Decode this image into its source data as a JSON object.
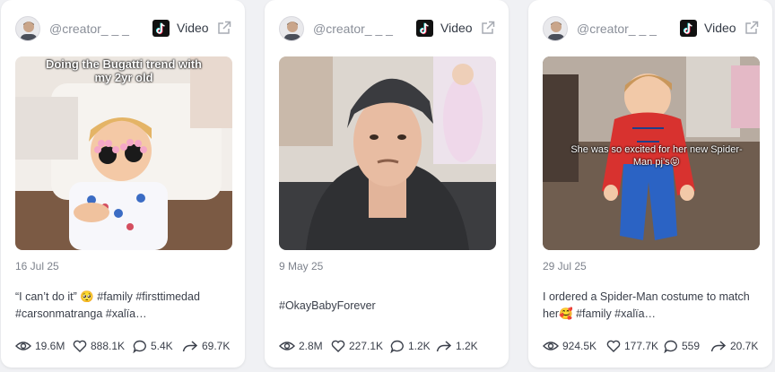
{
  "cards": [
    {
      "username": "@creator_ _ _",
      "platform": "Video",
      "date": "16 Jul 25",
      "overlay_text": "Doing the Bugatti trend with my 2yr old",
      "caption": "“I can’t do it” 🥺 #family #firsttimedad #carsonmatranga #xalïa…",
      "views": "19.6M",
      "likes": "888.1K",
      "comments": "5.4K",
      "shares": "69.7K"
    },
    {
      "username": "@creator_ _ _",
      "platform": "Video",
      "date": "9 May 25",
      "overlay_text": "",
      "caption": "#OkayBabyForever",
      "views": "2.8M",
      "likes": "227.1K",
      "comments": "1.2K",
      "shares": "1.2K"
    },
    {
      "username": "@creator_ _ _",
      "platform": "Video",
      "date": "29 Jul 25",
      "overlay_text": "She was so excited for her new Spider-Man pj’s😝",
      "caption": "I ordered a Spider-Man costume to match her🥰 #family #xalïa…",
      "views": "924.5K",
      "likes": "177.7K",
      "comments": "559",
      "shares": "20.7K"
    }
  ],
  "colors": {
    "card_bg": "#ffffff",
    "page_bg": "#f0f1f4",
    "muted": "#8a8f99",
    "text": "#3a3f4a"
  },
  "icons": [
    "avatar",
    "tiktok-icon",
    "external-link-icon",
    "eye-icon",
    "heart-icon",
    "comment-icon",
    "share-icon"
  ]
}
